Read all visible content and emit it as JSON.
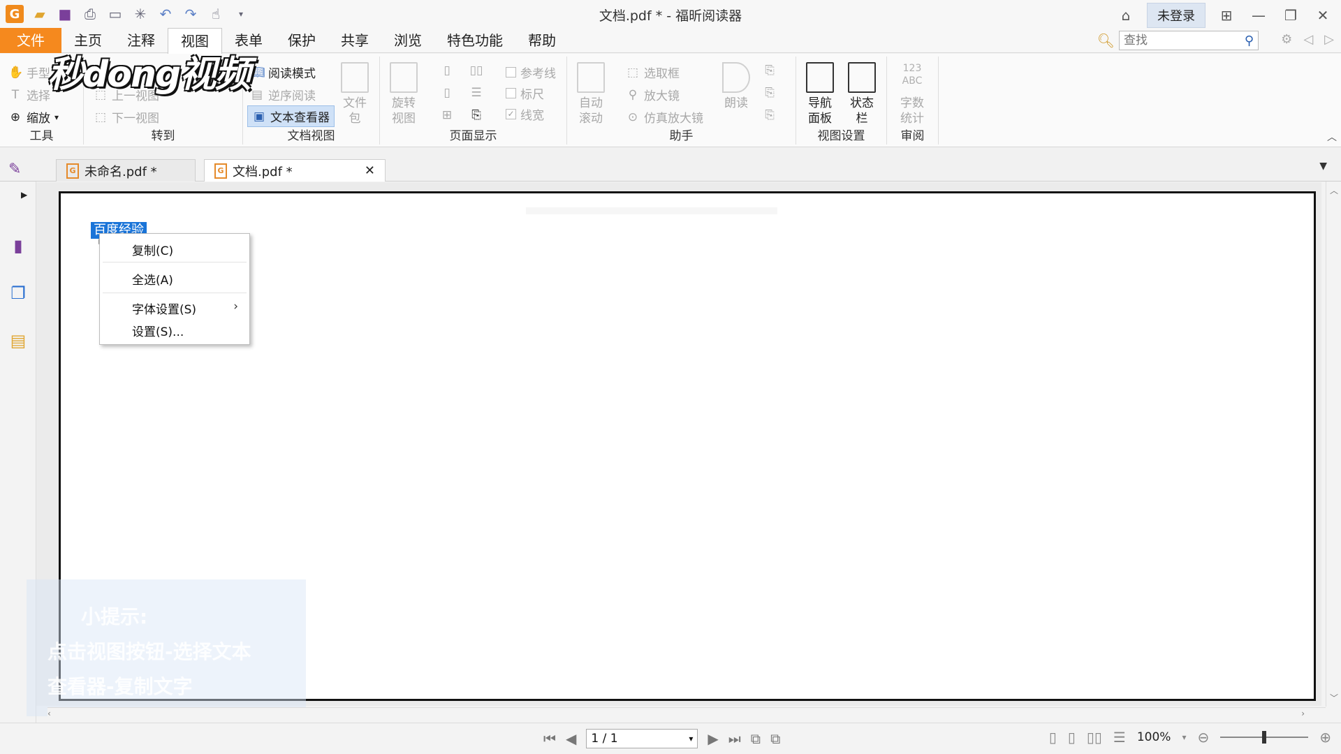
{
  "window": {
    "title": "文档.pdf * - 福昕阅读器",
    "login_label": "未登录"
  },
  "menu": {
    "tabs": [
      "文件",
      "主页",
      "注释",
      "视图",
      "表单",
      "保护",
      "共享",
      "浏览",
      "特色功能",
      "帮助"
    ],
    "active_tab": "视图",
    "search_placeholder": "查找"
  },
  "ribbon": {
    "tools": {
      "hand": "手型",
      "select": "选择",
      "zoom": "缩放",
      "label": "工具"
    },
    "goto": {
      "prev": "上一视图",
      "next": "下一视图",
      "label": "转到"
    },
    "docview": {
      "read_mode": "阅读模式",
      "reverse": "逆序阅读",
      "text_viewer": "文本查看器",
      "file_pkg_1": "文件",
      "file_pkg_2": "包",
      "label": "文档视图"
    },
    "pagedisplay": {
      "rotate_1": "旋转",
      "rotate_2": "视图",
      "guides": "参考线",
      "ruler": "标尺",
      "linewidth": "线宽",
      "label": "页面显示"
    },
    "assistant": {
      "auto_1": "自动",
      "auto_2": "滚动",
      "marquee": "选取框",
      "magnifier": "放大镜",
      "loupe": "仿真放大镜",
      "read_aloud": "朗读",
      "label": "助手"
    },
    "viewsettings": {
      "nav_1": "导航",
      "nav_2": "面板",
      "status_1": "状态",
      "status_2": "栏",
      "label": "视图设置"
    },
    "review": {
      "count_icon": "123 ABC",
      "count_1": "字数",
      "count_2": "统计",
      "label": "审阅"
    }
  },
  "watermark": "秒dong视频",
  "doc_tabs": [
    {
      "name": "未命名.pdf *"
    },
    {
      "name": "文档.pdf *"
    }
  ],
  "document": {
    "selected_text": "百度经验"
  },
  "context_menu": {
    "items": [
      "复制(C)",
      "全选(A)",
      "字体设置(S)",
      "设置(S)..."
    ]
  },
  "tip": {
    "title": "小提示:",
    "line1": "点击视图按钮-选择文本",
    "line2": "查看器-复制文字"
  },
  "statusbar": {
    "page": "1 / 1",
    "zoom": "100%"
  }
}
